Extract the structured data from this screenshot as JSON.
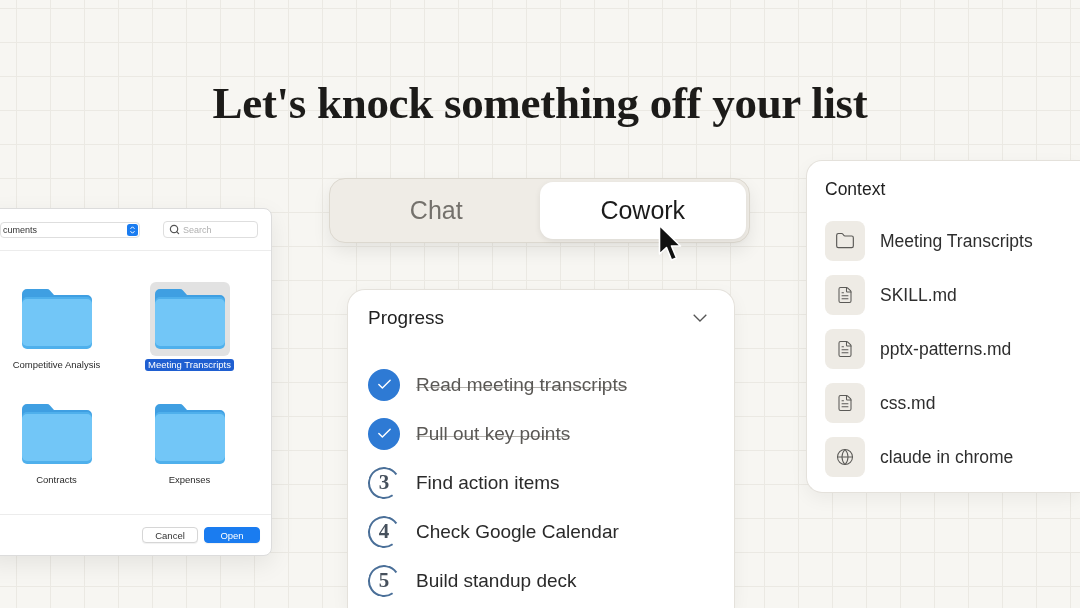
{
  "headline": "Let's knock something off your list",
  "file_dialog": {
    "location_dropdown": {
      "value": "cuments"
    },
    "search": {
      "placeholder": "Search"
    },
    "folders": [
      {
        "name": "Competitive Analysis",
        "selected": false
      },
      {
        "name": "Meeting Transcripts",
        "selected": true
      },
      {
        "name": "Contracts",
        "selected": false
      },
      {
        "name": "Expenses",
        "selected": false
      }
    ],
    "buttons": [
      {
        "label": "Cancel",
        "kind": "secondary"
      },
      {
        "label": "Open",
        "kind": "primary"
      }
    ]
  },
  "mode_toggle": {
    "tabs": [
      {
        "label": "Chat",
        "selected": false
      },
      {
        "label": "Cowork",
        "selected": true
      }
    ]
  },
  "progress": {
    "title": "Progress",
    "steps": [
      {
        "label": "Read meeting transcripts",
        "done": true
      },
      {
        "label": "Pull out key points",
        "done": true
      },
      {
        "label": "Find action items",
        "done": false,
        "step": "3"
      },
      {
        "label": "Check Google Calendar",
        "done": false,
        "step": "4"
      },
      {
        "label": "Build standup deck",
        "done": false,
        "step": "5"
      }
    ]
  },
  "context": {
    "title": "Context",
    "items": [
      {
        "label": "Meeting Transcripts",
        "kind": "folder"
      },
      {
        "label": "SKILL.md",
        "kind": "file"
      },
      {
        "label": "pptx-patterns.md",
        "kind": "file"
      },
      {
        "label": "css.md",
        "kind": "file"
      },
      {
        "label": "claude in chrome",
        "kind": "web"
      }
    ]
  }
}
